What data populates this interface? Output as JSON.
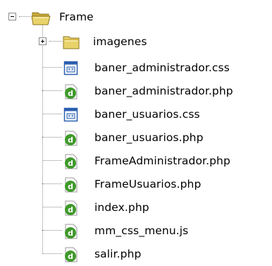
{
  "tree": {
    "root": {
      "label": "Frame",
      "expanded": true,
      "icon": "folder-open-icon"
    },
    "children": [
      {
        "label": "imagenes",
        "kind": "folder",
        "expanded": false,
        "icon": "folder-icon"
      },
      {
        "label": "baner_administrador.css",
        "kind": "css",
        "icon": "css-file-icon"
      },
      {
        "label": "baner_administrador.php",
        "kind": "php",
        "icon": "php-file-icon"
      },
      {
        "label": "baner_usuarios.css",
        "kind": "css",
        "icon": "css-file-icon"
      },
      {
        "label": "baner_usuarios.php",
        "kind": "php",
        "icon": "php-file-icon"
      },
      {
        "label": "FrameAdministrador.php",
        "kind": "php",
        "icon": "php-file-icon"
      },
      {
        "label": "FrameUsuarios.php",
        "kind": "php",
        "icon": "php-file-icon"
      },
      {
        "label": "index.php",
        "kind": "php",
        "icon": "php-file-icon"
      },
      {
        "label": "mm_css_menu.js",
        "kind": "js",
        "icon": "js-file-icon"
      },
      {
        "label": "salir.php",
        "kind": "php",
        "icon": "php-file-icon"
      }
    ]
  },
  "colors": {
    "folder": "#e8d36a",
    "folder_dark": "#c9a93a",
    "css_blue": "#2a5fb0",
    "php_green": "#3f9a2a",
    "connector": "#8a8a8a"
  }
}
